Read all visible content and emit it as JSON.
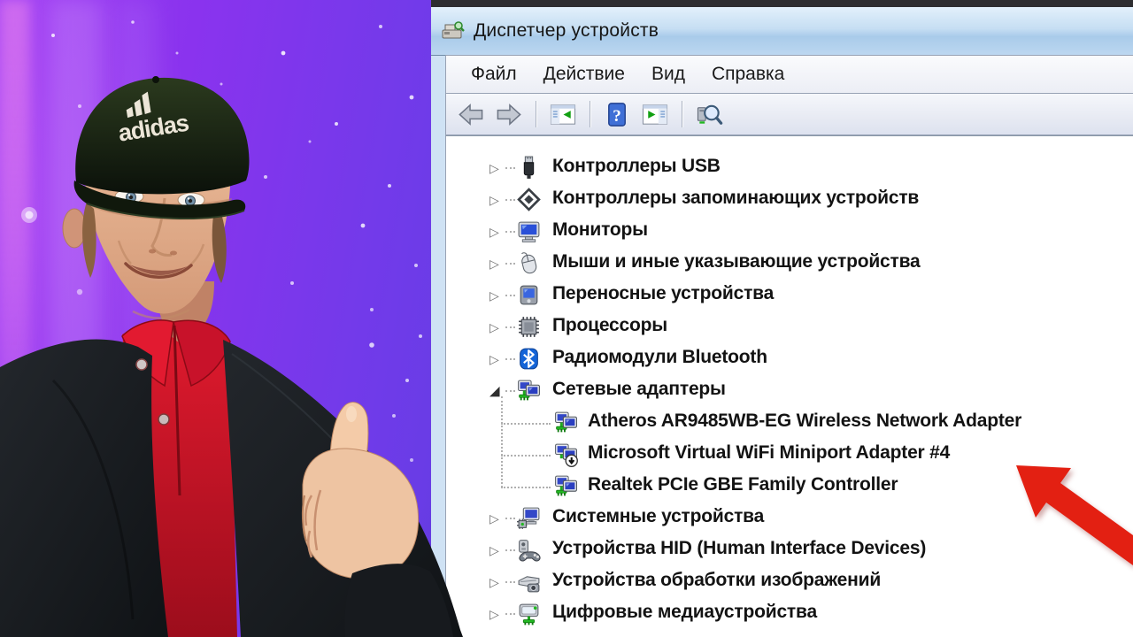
{
  "app": {
    "window_title": "Диспетчер устройств"
  },
  "menu": {
    "items": [
      {
        "id": "file",
        "label": "Файл"
      },
      {
        "id": "action",
        "label": "Действие"
      },
      {
        "id": "view",
        "label": "Вид"
      },
      {
        "id": "help",
        "label": "Справка"
      }
    ]
  },
  "toolbar": {
    "items": [
      {
        "type": "button",
        "name": "back",
        "icon": "back-arrow-icon",
        "symbol": "tb-back"
      },
      {
        "type": "button",
        "name": "forward",
        "icon": "forward-arrow-icon",
        "symbol": "tb-fwd"
      },
      {
        "type": "separator"
      },
      {
        "type": "button",
        "name": "show-hide-console-tree",
        "icon": "console-tree-icon",
        "symbol": "tb-tree"
      },
      {
        "type": "separator"
      },
      {
        "type": "button",
        "name": "help",
        "icon": "help-icon",
        "symbol": "tb-help"
      },
      {
        "type": "button",
        "name": "show-hide-action-pane",
        "icon": "action-pane-icon",
        "symbol": "tb-action"
      },
      {
        "type": "separator"
      },
      {
        "type": "button",
        "name": "scan-hardware-changes",
        "icon": "scan-hardware-icon",
        "symbol": "tb-scan"
      }
    ]
  },
  "tree": {
    "items": [
      {
        "label": "Контроллеры USB",
        "icon": "usb",
        "symbol": "ic-usb",
        "level": 0,
        "state": "collapsed"
      },
      {
        "label": "Контроллеры запоминающих устройств",
        "icon": "storage-controller",
        "symbol": "ic-storage",
        "level": 0,
        "state": "collapsed"
      },
      {
        "label": "Мониторы",
        "icon": "monitor",
        "symbol": "ic-monitor",
        "level": 0,
        "state": "collapsed"
      },
      {
        "label": "Мыши и иные указывающие устройства",
        "icon": "mouse",
        "symbol": "ic-mouse",
        "level": 0,
        "state": "collapsed"
      },
      {
        "label": "Переносные устройства",
        "icon": "portable-device",
        "symbol": "ic-portable",
        "level": 0,
        "state": "collapsed"
      },
      {
        "label": "Процессоры",
        "icon": "processor",
        "symbol": "ic-cpu",
        "level": 0,
        "state": "collapsed"
      },
      {
        "label": "Радиомодули Bluetooth",
        "icon": "bluetooth",
        "symbol": "ic-bt",
        "level": 0,
        "state": "collapsed"
      },
      {
        "label": "Сетевые адаптеры",
        "icon": "network-adapter",
        "symbol": "ic-net",
        "level": 0,
        "state": "expanded"
      },
      {
        "label": "Atheros AR9485WB-EG Wireless Network Adapter",
        "icon": "network-adapter",
        "symbol": "ic-net",
        "level": 1,
        "state": "leaf"
      },
      {
        "label": "Microsoft Virtual WiFi Miniport Adapter #4",
        "icon": "network-adapter-disabled",
        "symbol": "ic-netdis",
        "level": 1,
        "state": "leaf"
      },
      {
        "label": "Realtek PCIe GBE Family Controller",
        "icon": "network-adapter",
        "symbol": "ic-net",
        "level": 1,
        "state": "leaf"
      },
      {
        "label": "Системные устройства",
        "icon": "system-devices",
        "symbol": "ic-sys",
        "level": 0,
        "state": "collapsed"
      },
      {
        "label": "Устройства HID (Human Interface Devices)",
        "icon": "hid",
        "symbol": "ic-hid",
        "level": 0,
        "state": "collapsed"
      },
      {
        "label": "Устройства обработки изображений",
        "icon": "imaging",
        "symbol": "ic-img",
        "level": 0,
        "state": "collapsed"
      },
      {
        "label": "Цифровые медиаустройства",
        "icon": "media-device",
        "symbol": "ic-media",
        "level": 0,
        "state": "collapsed"
      }
    ]
  },
  "annotation": {
    "shape": "arrow",
    "color": "#e32012",
    "points_to": "Microsoft Virtual WiFi Miniport Adapter #4"
  },
  "person": {
    "cap_brand_text": "adidas",
    "gesture": "thumbs-up"
  },
  "colors": {
    "arrow": "#e32012",
    "titlebar": "#bcd7f0",
    "background_left": "#8d36ee",
    "background_right": "#473cd0",
    "shirt": "#cf1526",
    "jacket": "#16191d",
    "cap": "#141c10"
  }
}
